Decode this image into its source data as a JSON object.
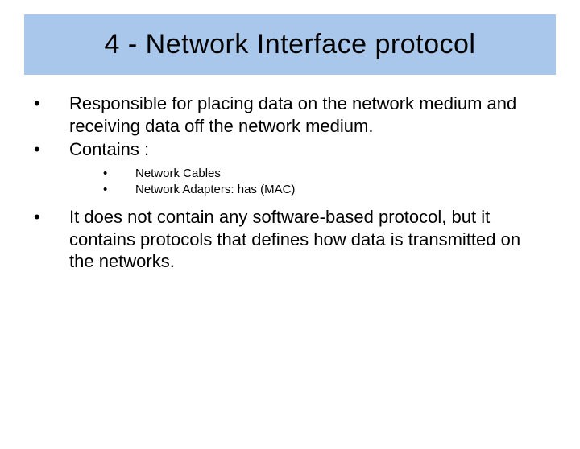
{
  "title": "4 - Network Interface protocol",
  "bullets": [
    {
      "mark": "•",
      "text": "Responsible for placing data on the network medium and receiving data off the network medium."
    },
    {
      "mark": "•",
      "text": "Contains :"
    }
  ],
  "sub_bullets": [
    {
      "mark": "•",
      "text": "Network Cables"
    },
    {
      "mark": "•",
      "text": "Network Adapters: has (MAC)"
    }
  ],
  "bullet_after": {
    "mark": "•",
    "text": "It does not contain any software-based protocol, but it contains protocols that defines how data is transmitted on the networks."
  },
  "colors": {
    "title_bg": "#a9c7ea"
  }
}
